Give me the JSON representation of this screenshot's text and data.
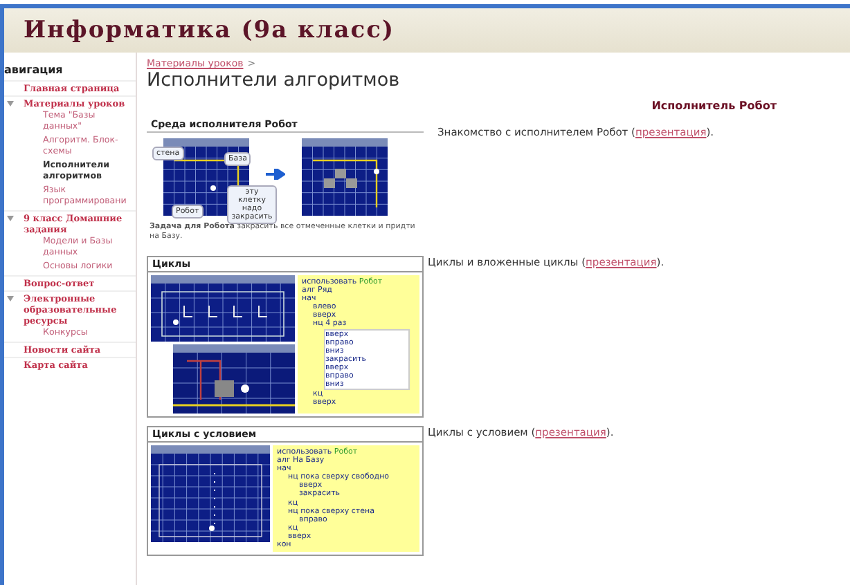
{
  "header": {
    "title": "Информатика (9а класс)"
  },
  "sidebar": {
    "heading": "авигация",
    "items": [
      {
        "label": "Главная страница",
        "selected": false,
        "expanded": false
      },
      {
        "label": "Материалы уроков",
        "selected": false,
        "expanded": true,
        "children": [
          {
            "label": "Тема \"Базы данных\"",
            "selected": false
          },
          {
            "label": "Алгоритм. Блок-схемы",
            "selected": false
          },
          {
            "label": "Исполнители алгоритмов",
            "selected": true
          },
          {
            "label": "Язык программировани",
            "selected": false
          }
        ]
      },
      {
        "label": "9 класс Домашние задания",
        "selected": false,
        "expanded": true,
        "children": [
          {
            "label": "Модели и Базы данных",
            "selected": false
          },
          {
            "label": "Основы логики",
            "selected": false
          }
        ]
      },
      {
        "label": "Вопрос-ответ",
        "selected": false,
        "expanded": false
      },
      {
        "label": "Электронные образовательные ресурсы",
        "selected": false,
        "expanded": true,
        "children": [
          {
            "label": "Конкурсы",
            "selected": false
          }
        ]
      },
      {
        "label": "Новости сайта",
        "selected": false,
        "expanded": false
      },
      {
        "label": "Карта сайта",
        "selected": false,
        "expanded": false
      }
    ]
  },
  "content": {
    "breadcrumb": {
      "link": "Материалы уроков",
      "separator": ">"
    },
    "title": "Исполнители алгоритмов",
    "section_heading": "Исполнитель Робот",
    "lessons": [
      {
        "kind": "robot",
        "panel_title": "Среда исполнителя Робот",
        "labels": [
          "стена",
          "База",
          "эту клетку надо закрасить",
          "Робот"
        ],
        "caption": "**Задача для Робота**  закрасить все отмеченные клетки и придти на Базу.",
        "text_before": "Знакомство с исполнителем Робот (",
        "link": "презентация",
        "text_after": ")."
      },
      {
        "kind": "loops",
        "panel_title": "Циклы",
        "code": [
          {
            "text": "использовать",
            "tail": "Робот"
          },
          {
            "text": "алг Ряд"
          },
          {
            "text": "нач",
            "children": [
              {
                "text": "влево"
              },
              {
                "text": "вверх"
              },
              {
                "text": "нц 4 раз",
                "boxed": true,
                "children": [
                  {
                    "text": "вверх"
                  },
                  {
                    "text": "вправо"
                  },
                  {
                    "text": "вниз"
                  },
                  {
                    "text": "закрасить"
                  },
                  {
                    "text": "вверх"
                  },
                  {
                    "text": "вправо"
                  },
                  {
                    "text": "вниз"
                  }
                ]
              },
              {
                "text": "кц"
              },
              {
                "text": "вверх"
              }
            ]
          }
        ],
        "text_before": "Циклы и вложенные циклы (",
        "link": "презентация",
        "text_after": ")."
      },
      {
        "kind": "conditional",
        "panel_title": "Циклы с условием",
        "code": [
          {
            "text": "использовать",
            "tail": "Робот"
          },
          {
            "text": "алг На Базу"
          },
          {
            "text": "нач",
            "children": [
              {
                "text": "нц пока сверху свободно",
                "boxed": false,
                "children": [
                  {
                    "text": "вверх"
                  },
                  {
                    "text": "закрасить"
                  }
                ]
              },
              {
                "text": "кц"
              },
              {
                "text": "нц пока сверху стена",
                "boxed": false,
                "children": [
                  {
                    "text": "вправо"
                  }
                ]
              },
              {
                "text": "кц"
              },
              {
                "text": "вверх"
              }
            ]
          },
          {
            "text": "кон"
          }
        ],
        "text_before": "Циклы с условием (",
        "link": "презентация",
        "text_after": ")."
      }
    ]
  }
}
